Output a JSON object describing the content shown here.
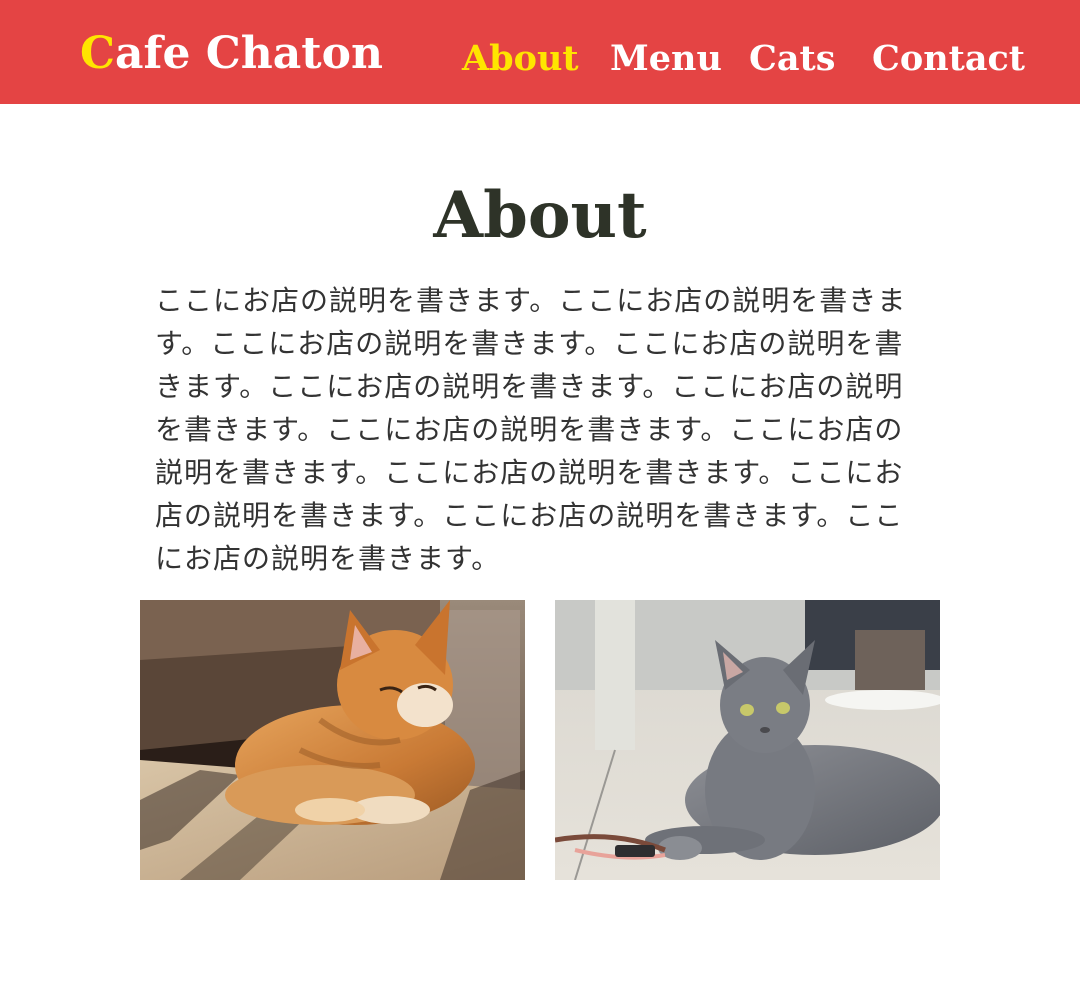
{
  "header": {
    "logo_initial": "C",
    "logo_rest": "afe Chaton",
    "nav": [
      {
        "label": "About",
        "active": true
      },
      {
        "label": "Menu",
        "active": false
      },
      {
        "label": "Cats",
        "active": false
      },
      {
        "label": "Contact",
        "active": false
      }
    ]
  },
  "main": {
    "title": "About",
    "description": "ここにお店の説明を書きます。ここにお店の説明を書きます。ここにお店の説明を書きます。ここにお店の説明を書きます。ここにお店の説明を書きます。ここにお店の説明を書きます。ここにお店の説明を書きます。ここにお店の説明を書きます。ここにお店の説明を書きます。ここにお店の説明を書きます。ここにお店の説明を書きます。ここにお店の説明を書きます。",
    "photos": [
      {
        "subject": "orange-tabby-cat-by-window"
      },
      {
        "subject": "gray-cat-lying-on-floor"
      }
    ]
  },
  "colors": {
    "header_bg": "#e44444",
    "accent": "#ffe500",
    "nav_text": "#ffffff",
    "title_text": "#2e3328",
    "body_text": "#333333"
  }
}
